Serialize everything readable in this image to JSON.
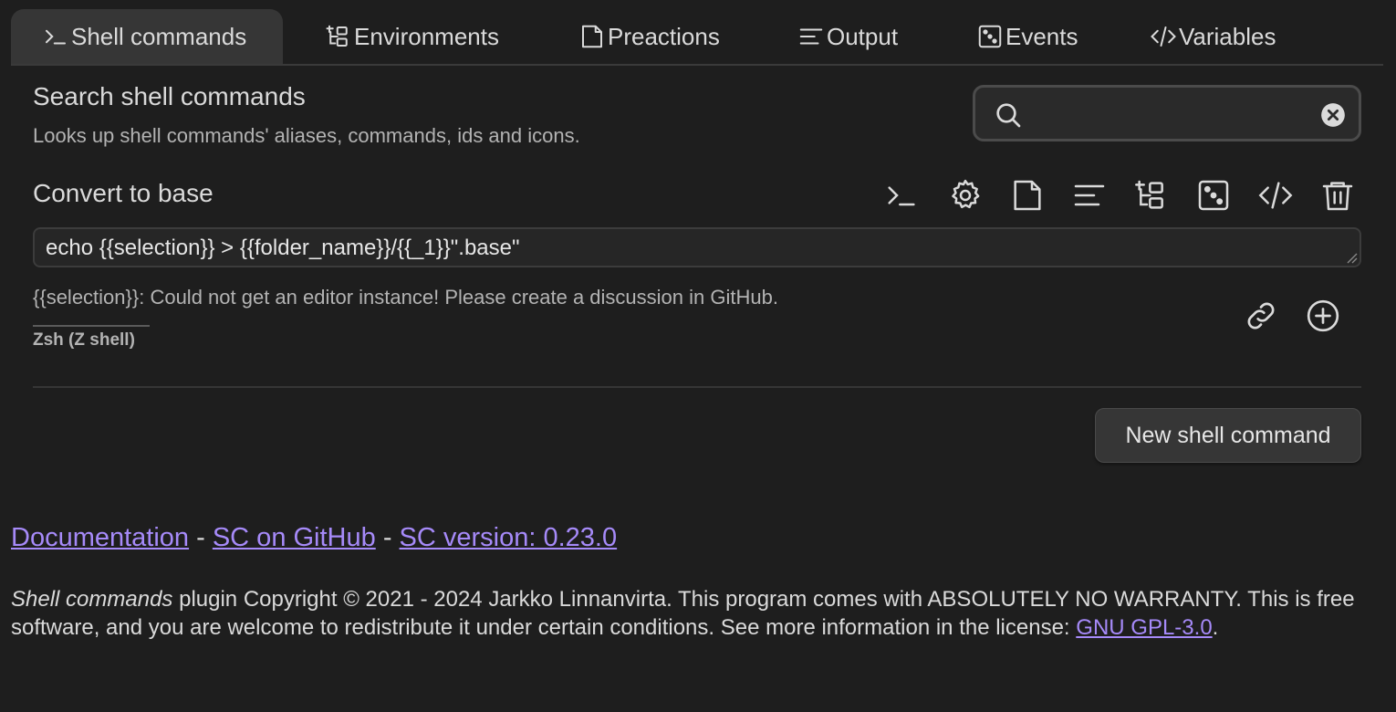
{
  "tabs": [
    {
      "label": "Shell commands",
      "icon": "terminal-icon",
      "active": true
    },
    {
      "label": "Environments",
      "icon": "environments-icon",
      "active": false
    },
    {
      "label": "Preactions",
      "icon": "file-icon",
      "active": false
    },
    {
      "label": "Output",
      "icon": "align-left-icon",
      "active": false
    },
    {
      "label": "Events",
      "icon": "dice-icon",
      "active": false
    },
    {
      "label": "Variables",
      "icon": "code-icon",
      "active": false
    }
  ],
  "search": {
    "title": "Search shell commands",
    "description": "Looks up shell commands' aliases, commands, ids and icons.",
    "value": "",
    "placeholder": ""
  },
  "command": {
    "alias": "Convert to base",
    "value": "echo {{selection}} > {{folder_name}}/{{_1}}\".base\"",
    "error": "{{selection}}: Could not get an editor instance! Please create a discussion in GitHub.",
    "shell": "Zsh (Z shell)",
    "toolbar_icons": [
      "terminal-icon",
      "gear-icon",
      "file-icon",
      "align-left-icon",
      "environments-icon",
      "dice-icon",
      "code-icon",
      "trash-icon"
    ]
  },
  "new_button": "New shell command",
  "footer": {
    "link_documentation": "Documentation",
    "sep1": " - ",
    "link_github": "SC on GitHub",
    "sep2": " - ",
    "link_version": "SC version: 0.23.0",
    "license_em": "Shell commands",
    "license_text": " plugin Copyright © 2021 - 2024 Jarkko Linnanvirta. This program comes with ABSOLUTELY NO WARRANTY. This is free software, and you are welcome to redistribute it under certain conditions. See more information in the license: ",
    "license_link": "GNU GPL-3.0",
    "license_end": "."
  },
  "colors": {
    "background": "#1e1e1e",
    "accent_link": "#a68af9",
    "active_tab": "#363636"
  }
}
